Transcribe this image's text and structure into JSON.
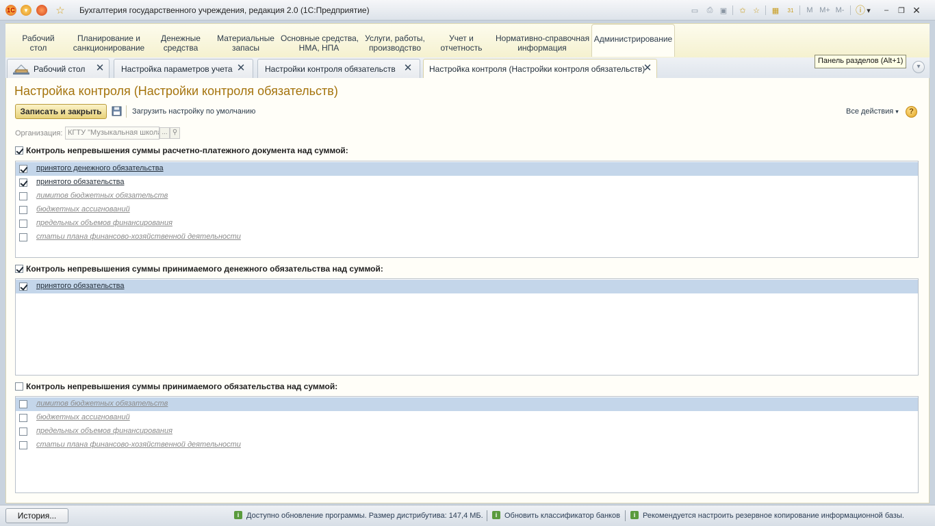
{
  "window": {
    "title": "Бухгалтерия государственного учреждения, редакция 2.0  (1С:Предприятие)",
    "tools": {
      "m": "M",
      "m_plus": "M+",
      "m_minus": "M-",
      "calendar_day": "31"
    }
  },
  "sections": [
    {
      "label": "Рабочий\nстол"
    },
    {
      "label": "Планирование и\nсанкционирование"
    },
    {
      "label": "Денежные\nсредства"
    },
    {
      "label": "Материальные\nзапасы"
    },
    {
      "label": "Основные средства,\nНМА, НПА"
    },
    {
      "label": "Услуги, работы,\nпроизводство"
    },
    {
      "label": "Учет и\nотчетность"
    },
    {
      "label": "Нормативно-справочная\nинформация"
    },
    {
      "label": "Администрирование"
    }
  ],
  "tabs": [
    {
      "label": "Рабочий стол"
    },
    {
      "label": "Настройка параметров учета"
    },
    {
      "label": "Настройки контроля обязательств"
    },
    {
      "label": "Настройка контроля (Настройки контроля обязательств)"
    }
  ],
  "panel_hint": "Панель разделов (Alt+1)",
  "form": {
    "title": "Настройка контроля (Настройки контроля обязательств)",
    "save_close": "Записать и закрыть",
    "load_defaults": "Загрузить настройку по умолчанию",
    "all_actions": "Все действия",
    "help": "?",
    "org_label": "Организация:",
    "org_value": "КГТУ \"Музыкальная школа",
    "org_choose": "...",
    "group1": {
      "title": "Контроль непревышения суммы расчетно-платежного документа над суммой:",
      "checked": true,
      "items": [
        {
          "label": "принятого денежного обязательства",
          "checked": true,
          "enabled": true
        },
        {
          "label": "принятого обязательства",
          "checked": true,
          "enabled": true
        },
        {
          "label": "лимитов бюджетных обязательств",
          "checked": false,
          "enabled": false
        },
        {
          "label": "бюджетных ассигнований",
          "checked": false,
          "enabled": false
        },
        {
          "label": "предельных объемов финансирования",
          "checked": false,
          "enabled": false
        },
        {
          "label": "статьи плана финансово-хозяйственной деятельности",
          "checked": false,
          "enabled": false
        }
      ]
    },
    "group2": {
      "title": "Контроль непревышения суммы принимаемого денежного обязательства над суммой:",
      "checked": true,
      "items": [
        {
          "label": "принятого обязательства",
          "checked": true,
          "enabled": true
        }
      ]
    },
    "group3": {
      "title": "Контроль непревышения суммы принимаемого обязательства над суммой:",
      "checked": false,
      "items": [
        {
          "label": "лимитов бюджетных обязательств",
          "checked": false,
          "enabled": false
        },
        {
          "label": "бюджетных ассигнований",
          "checked": false,
          "enabled": false
        },
        {
          "label": "предельных объемов финансирования",
          "checked": false,
          "enabled": false
        },
        {
          "label": "статьи плана финансово-хозяйственной деятельности",
          "checked": false,
          "enabled": false
        }
      ]
    }
  },
  "status": {
    "history": "История...",
    "messages": [
      "Доступно обновление программы. Размер дистрибутива: 147,4 МБ.",
      "Обновить классификатор банков",
      "Рекомендуется настроить резервное копирование информационной базы."
    ]
  },
  "colors": {
    "title_accent": "#a4730c",
    "selected_row": "#c4d6ea",
    "section_panel": "#f5f1cf"
  }
}
